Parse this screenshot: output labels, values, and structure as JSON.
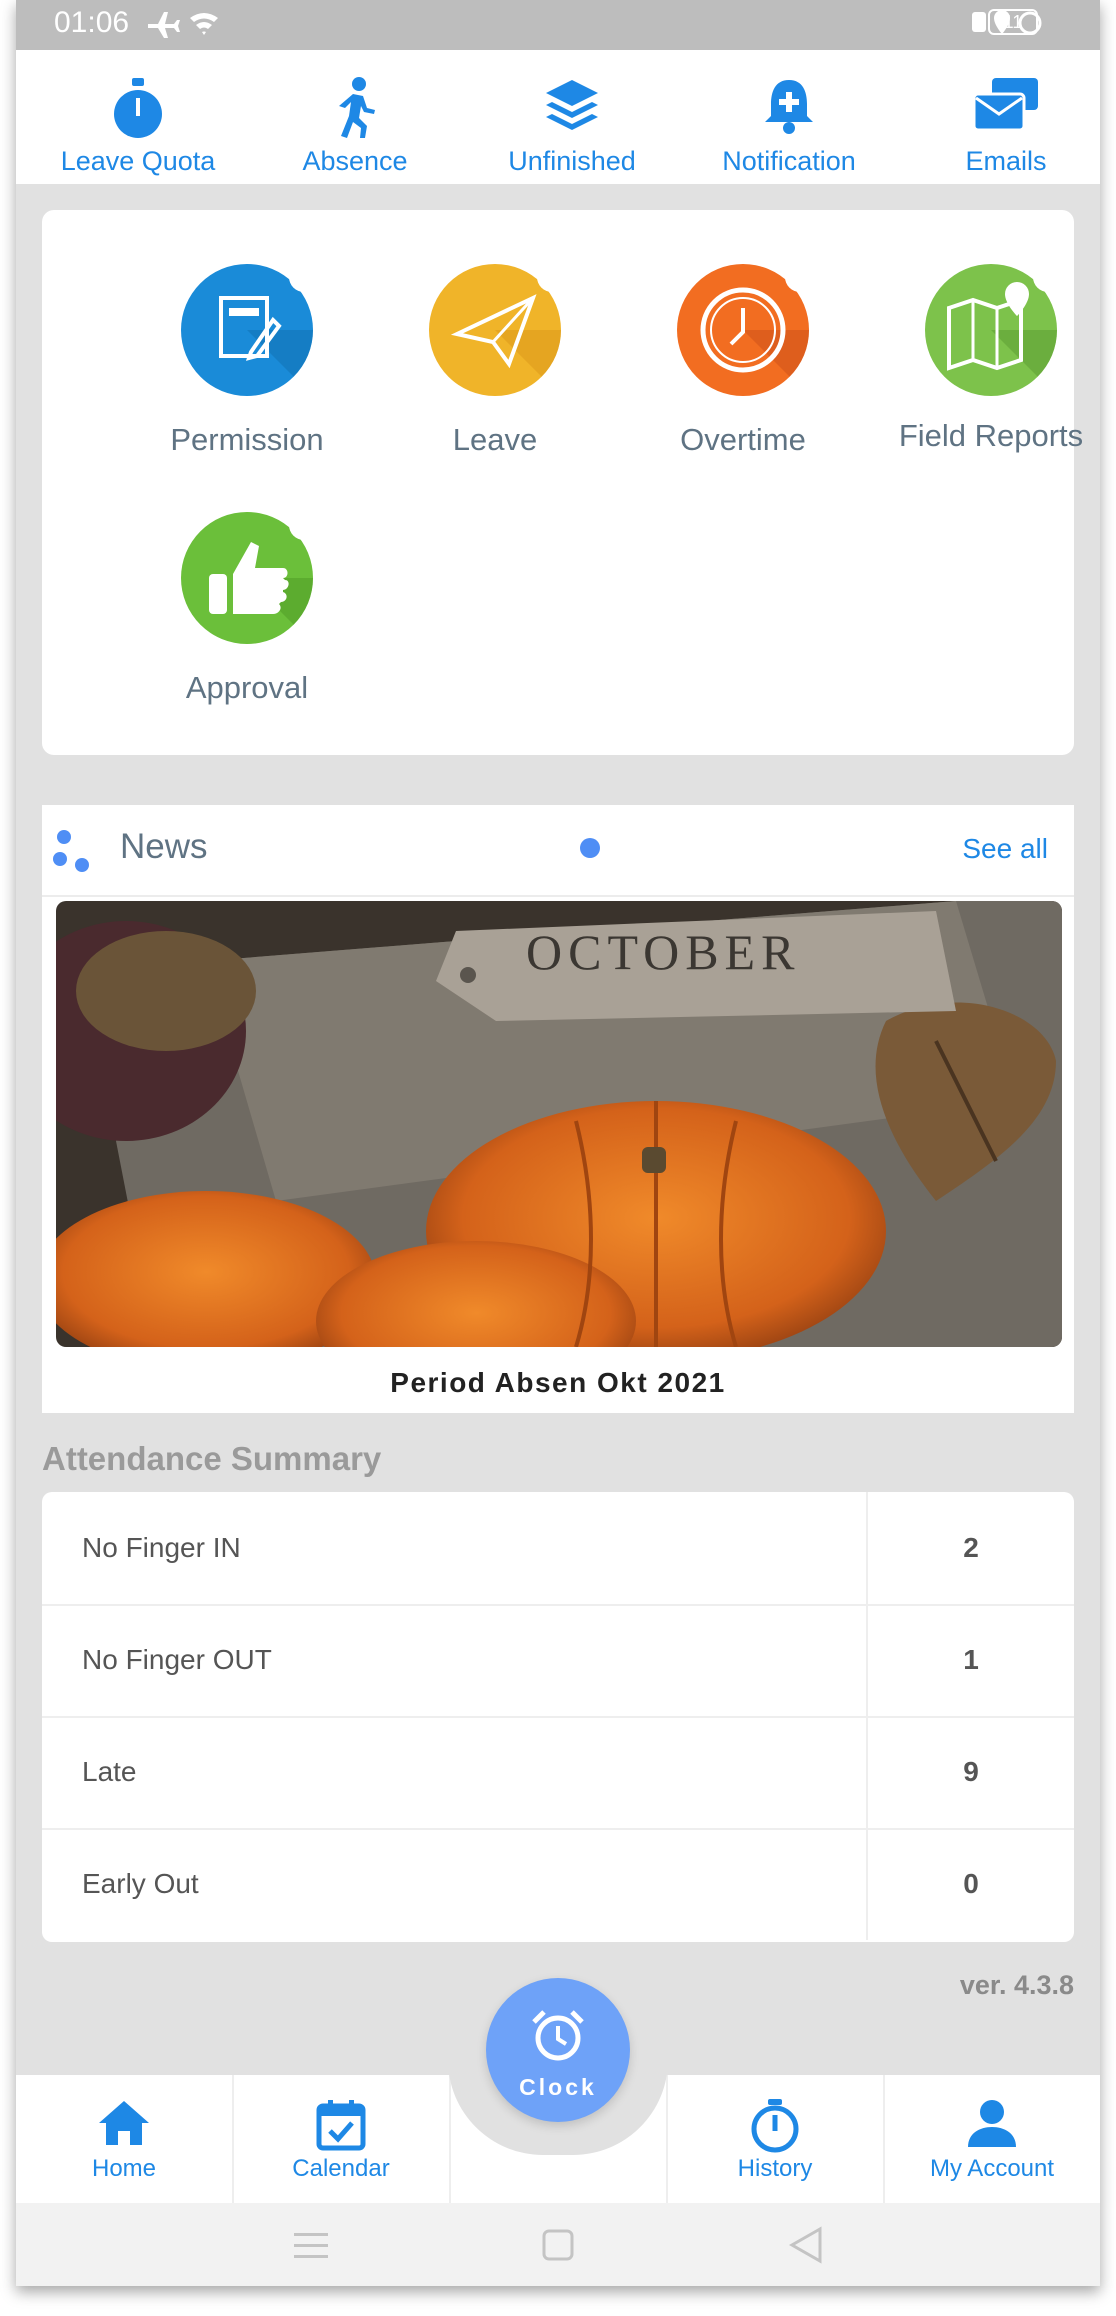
{
  "status_bar": {
    "time": "01:06",
    "battery": "11"
  },
  "top_shortcuts": [
    {
      "label": "Leave Quota",
      "icon": "stopwatch-icon"
    },
    {
      "label": "Absence",
      "icon": "walking-person-icon"
    },
    {
      "label": "Unfinished",
      "icon": "layers-icon"
    },
    {
      "label": "Notification",
      "icon": "bell-plus-icon"
    },
    {
      "label": "Emails",
      "icon": "envelopes-icon"
    }
  ],
  "features": [
    {
      "label": "Permission",
      "icon": "document-edit-icon",
      "color": "#1a8bd8"
    },
    {
      "label": "Leave",
      "icon": "paper-plane-icon",
      "color": "#f0b429"
    },
    {
      "label": "Overtime",
      "icon": "clock-icon",
      "color": "#f26d21"
    },
    {
      "label": "Field Reports",
      "icon": "map-pin-icon",
      "color": "#7dc24b"
    },
    {
      "label": "Approval",
      "icon": "thumbs-up-icon",
      "color": "#6bbf3a"
    }
  ],
  "news": {
    "title": "News",
    "see_all": "See all",
    "image_text": "OCTOBER",
    "caption": "Period Absen Okt 2021"
  },
  "attendance": {
    "title": "Attendance Summary",
    "rows": [
      {
        "label": "No Finger IN",
        "value": "2"
      },
      {
        "label": "No Finger OUT",
        "value": "1"
      },
      {
        "label": "Late",
        "value": "9"
      },
      {
        "label": "Early Out",
        "value": "0"
      }
    ]
  },
  "version": "ver. 4.3.8",
  "clock_button": {
    "label": "Clock"
  },
  "bottom_nav": [
    {
      "label": "Home",
      "icon": "home-icon"
    },
    {
      "label": "Calendar",
      "icon": "calendar-icon"
    },
    {
      "label": "History",
      "icon": "stopwatch-icon"
    },
    {
      "label": "My Account",
      "icon": "person-icon"
    }
  ],
  "colors": {
    "accent": "#1e88e5",
    "clock_button": "#6ea2f8"
  }
}
